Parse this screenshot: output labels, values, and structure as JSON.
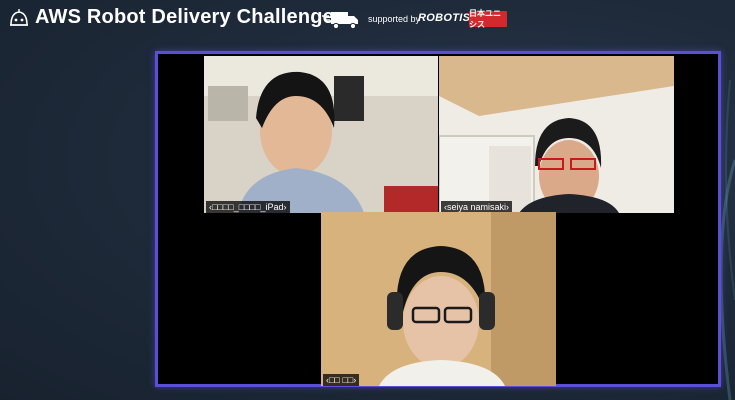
{
  "header": {
    "title": "AWS Robot Delivery Challenge",
    "supported_by": "supported by",
    "sponsor_1": "ROBOTIS",
    "sponsor_2": "日本ユニシス",
    "icons": [
      "robot-logo-icon",
      "delivery-truck-icon"
    ]
  },
  "video_call": {
    "participants": [
      {
        "label": "‹□□□□_□□□□_iPad›"
      },
      {
        "label": "‹seiya namisaki›"
      },
      {
        "label": "‹□□ □□›"
      }
    ]
  },
  "colors": {
    "frame_border": "#5a4fd6",
    "background": "#1f2b3b",
    "sponsor_badge": "#d3282e"
  }
}
